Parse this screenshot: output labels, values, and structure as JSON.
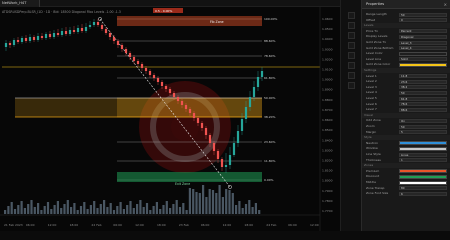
{
  "window": {
    "tab_title": "NetWork_H4T"
  },
  "chart": {
    "header_text": "ATDSRUSDPerp.BLSR_I1D · 1D · Bid: 18500  Diagonal  Fibo  Levels -1.00  -1.3",
    "fib_levels": [
      {
        "label": "100.00%",
        "price": "1.9488"
      },
      {
        "label": "88.60%",
        "price": "1.9312"
      },
      {
        "label": "78.60%",
        "price": "1.9154"
      },
      {
        "label": "61.80%",
        "price": "1.8896"
      },
      {
        "label": "50.00%",
        "price": "1.8714"
      },
      {
        "label": "38.20%",
        "price": "1.8532"
      },
      {
        "label": "23.60%",
        "price": "1.8306"
      },
      {
        "label": "11.80%",
        "price": "1.8124"
      },
      {
        "label": "0.00%",
        "price": "1.7942"
      }
    ],
    "labels": {
      "top_zone_badge": "0.5  -   0.00%",
      "top_zone_text": "Fib Zone",
      "bottom_zone_text": "Exit Zone"
    },
    "price_axis": [
      "1.9600",
      "1.9500",
      "1.9400",
      "1.9300",
      "1.9200",
      "1.9100",
      "1.9000",
      "1.8900",
      "1.8800",
      "1.8700",
      "1.8600",
      "1.8500",
      "1.8400",
      "1.8300",
      "1.8200",
      "1.8100",
      "1.8000",
      "1.7900",
      "1.7800",
      "1.7700"
    ],
    "time_axis": [
      "21 Feb 2023",
      "06:00",
      "12:00",
      "18:00",
      "22 Feb",
      "06:00",
      "12:00",
      "18:00",
      "23 Feb",
      "06:00",
      "12:00",
      "18:00",
      "24 Feb",
      "06:00",
      "12:00"
    ],
    "colors": {
      "bull": "#26a69a",
      "bear": "#ef5350",
      "fib_line": "#b0b0b0",
      "golden_zone": "#e8a317",
      "top_zone": "#e8542a",
      "bottom_zone": "#1f9d55",
      "volume": "#5b6b7a",
      "accent": "#f5c518"
    }
  },
  "panel": {
    "title": "Properties",
    "rows": [
      {
        "label": "Range Length",
        "value": "50"
      },
      {
        "label": "Offset",
        "value": "0"
      },
      {
        "section": "Levels"
      },
      {
        "label": "Price Tx",
        "value": "Percent"
      },
      {
        "label": "Display Levels",
        "value": "Diagonal"
      },
      {
        "label": "Gold Zone Tx",
        "value": "Level_3"
      },
      {
        "label": "Gold Zone Bottom",
        "value": "Level_4"
      },
      {
        "label": "Level Color",
        "swatch": "#1e1e1e"
      },
      {
        "label": "Level Line",
        "value": "Solid"
      },
      {
        "label": "Gold Zone Color",
        "swatch": "#f5c518"
      },
      {
        "section": "Settings"
      },
      {
        "label": "Level 1",
        "value": "11.8"
      },
      {
        "label": "Level 2",
        "value": "23.6"
      },
      {
        "label": "Level 3",
        "value": "38.2"
      },
      {
        "label": "Level 4",
        "value": "50"
      },
      {
        "label": "Level 5",
        "value": "61.8"
      },
      {
        "label": "Level 6",
        "value": "78.6"
      },
      {
        "label": "Level 7",
        "value": "88.6"
      },
      {
        "section": "Visual"
      },
      {
        "label": "Odd Zone",
        "value": "On"
      },
      {
        "label": "Zoom",
        "value": "50"
      },
      {
        "label": "Margin",
        "value": "5"
      },
      {
        "section": "Style"
      },
      {
        "label": "Neutron",
        "swatch": "#2f8fd8"
      },
      {
        "label": "Window",
        "swatch": "#c7c7c7"
      },
      {
        "label": "Line Style",
        "value": "Lines"
      },
      {
        "label": "Thickness",
        "value": "1"
      },
      {
        "section": "Zones"
      },
      {
        "label": "Premium",
        "swatch": "#e8542a"
      },
      {
        "label": "Discount",
        "swatch": "#1f9d55"
      },
      {
        "label": "Middle",
        "swatch": "#ffffff"
      },
      {
        "label": "Zone Transp",
        "value": "80"
      },
      {
        "label": "Zone Font Size",
        "value": "6"
      }
    ]
  }
}
